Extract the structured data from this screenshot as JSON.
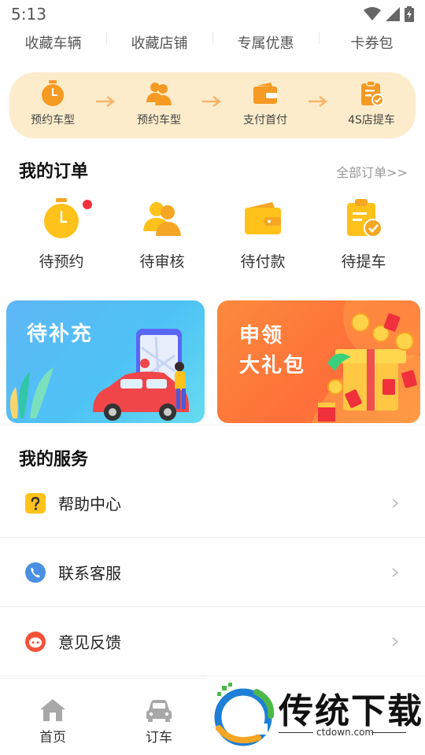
{
  "status_bar": {
    "time": "5:13"
  },
  "top_tabs": [
    "收藏车辆",
    "收藏店铺",
    "专属优惠",
    "卡券包"
  ],
  "process_steps": [
    "预约车型",
    "预约车型",
    "支付首付",
    "4S店提车"
  ],
  "orders": {
    "title": "我的订单",
    "view_all": "全部订单>>",
    "items": [
      {
        "label": "待预约",
        "icon": "alarm-clock-icon",
        "has_badge": true
      },
      {
        "label": "待审核",
        "icon": "users-icon"
      },
      {
        "label": "待付款",
        "icon": "wallet-icon"
      },
      {
        "label": "待提车",
        "icon": "clipboard-check-icon"
      }
    ]
  },
  "banners": {
    "left": {
      "text": "待补充"
    },
    "right": {
      "line1": "申领",
      "line2": "大礼包"
    }
  },
  "services": {
    "title": "我的服务",
    "items": [
      {
        "label": "帮助中心",
        "icon": "question-icon",
        "color": "#FFC21A"
      },
      {
        "label": "联系客服",
        "icon": "phone-icon",
        "color": "#4A90E2"
      },
      {
        "label": "意见反馈",
        "icon": "feedback-icon",
        "color": "#F4533A"
      }
    ]
  },
  "bottom_nav": [
    {
      "label": "首页",
      "icon": "home-icon"
    },
    {
      "label": "订车",
      "icon": "car-icon"
    }
  ],
  "watermark": {
    "text": "传统下载",
    "url": "ctdown.com"
  },
  "colors": {
    "accent": "#FFC21A",
    "accent_dark": "#F5A623",
    "process_bg": "#FDECCB"
  }
}
